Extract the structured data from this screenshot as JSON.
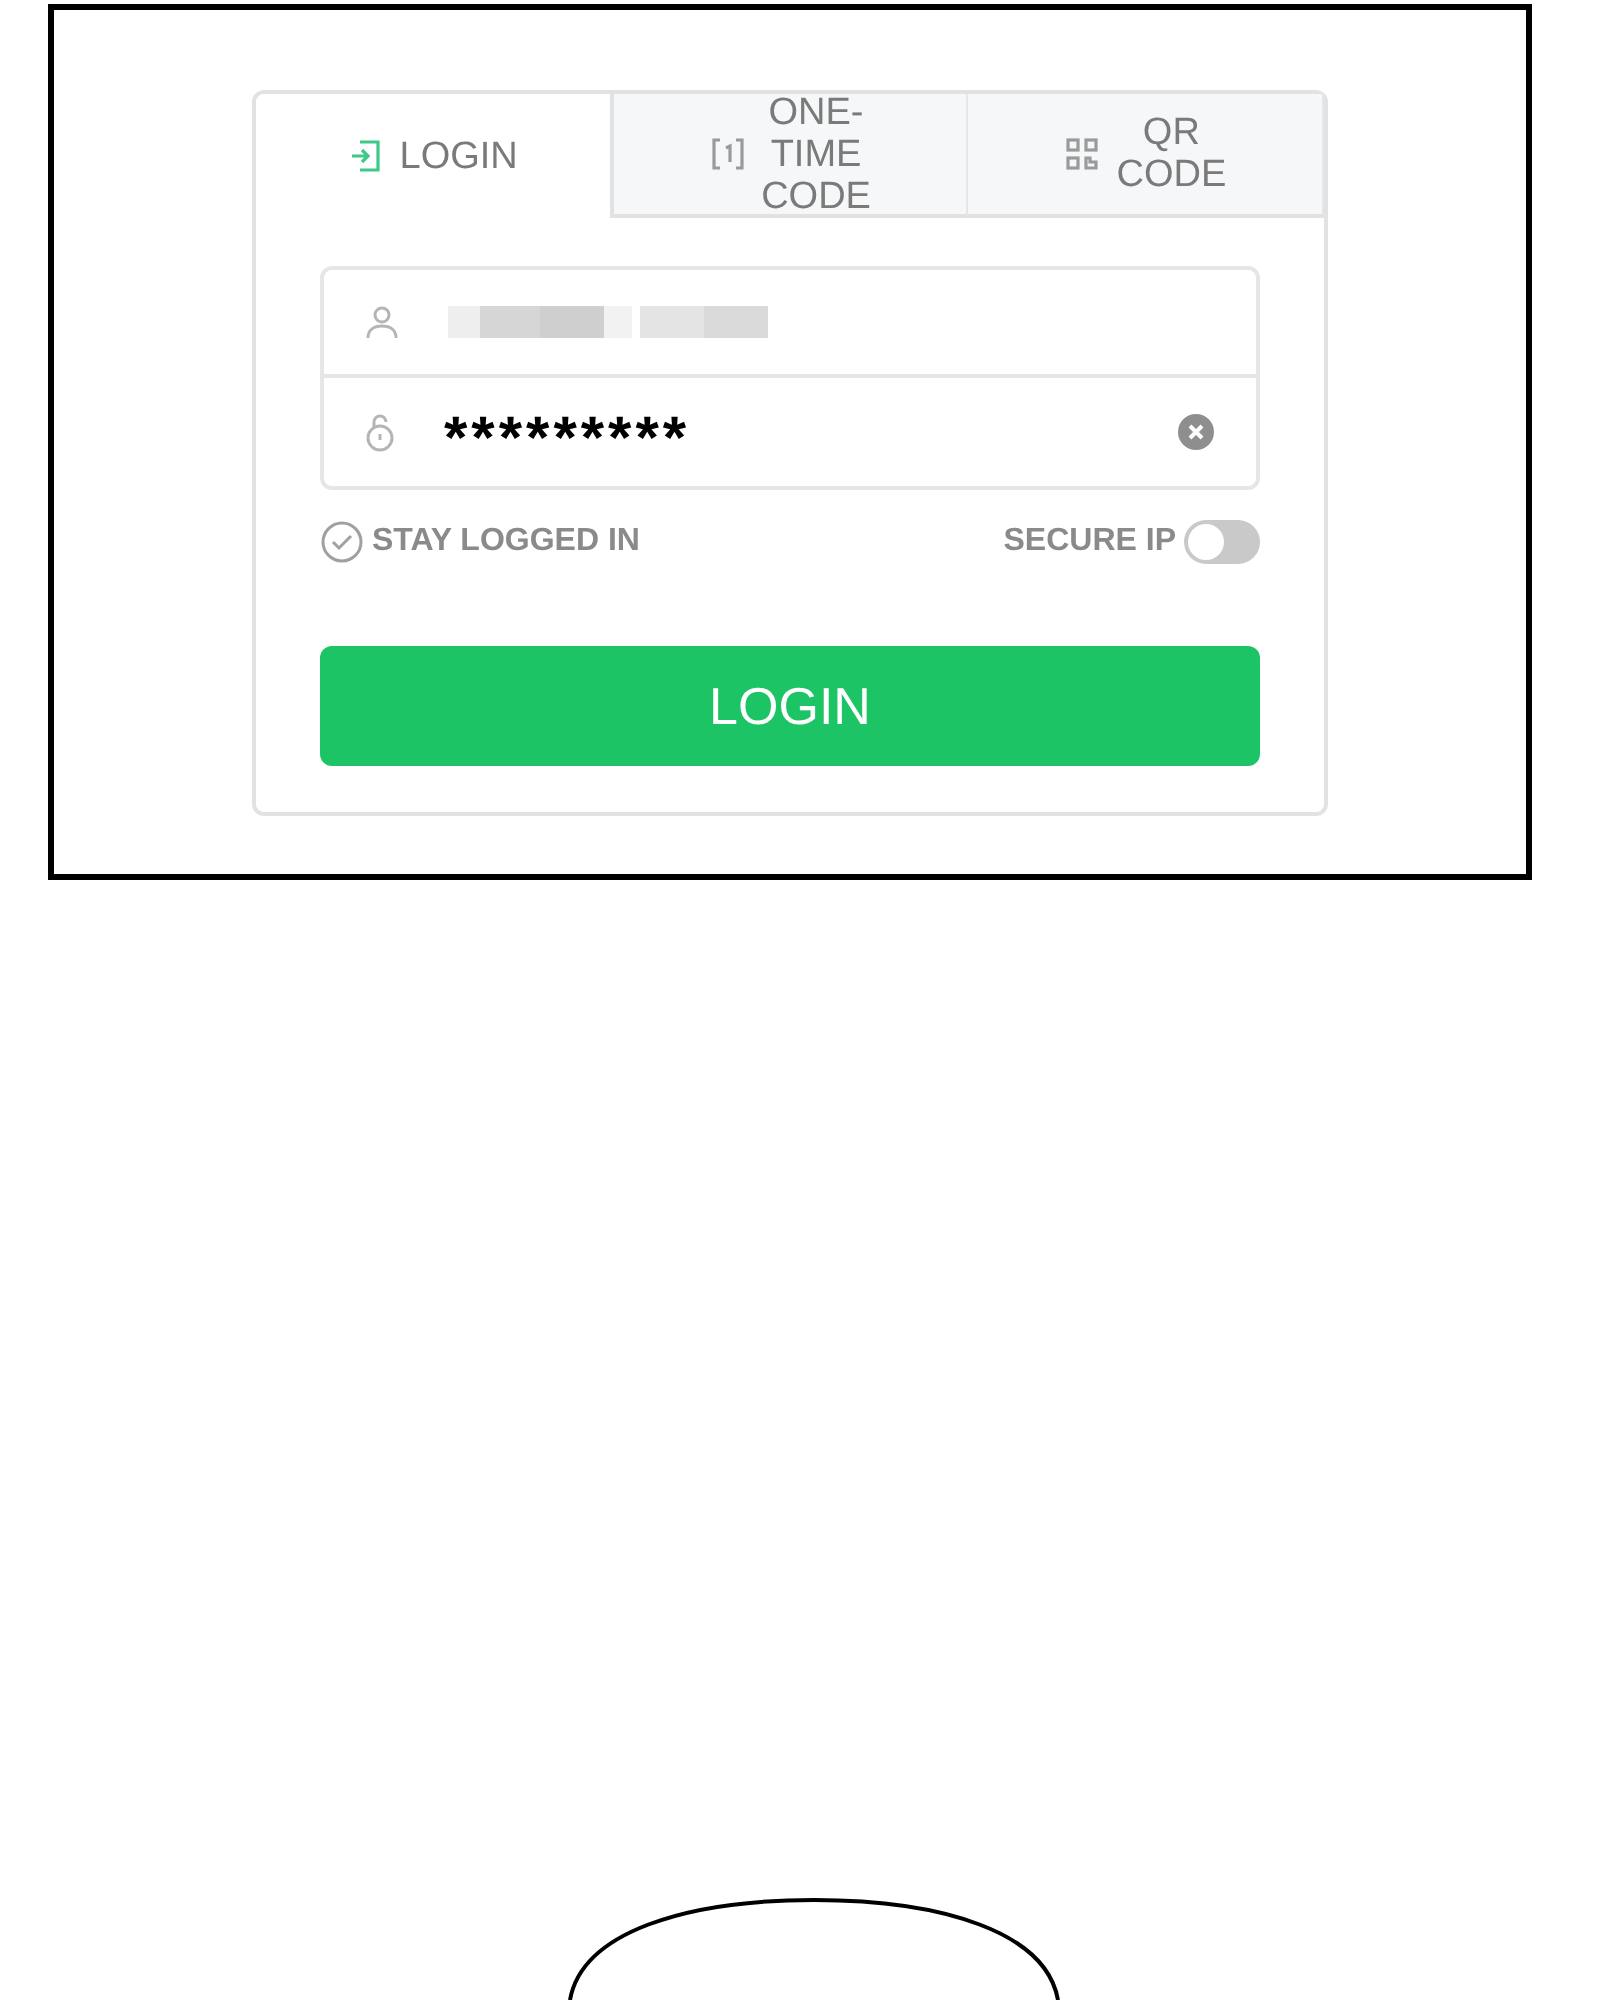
{
  "tabs": [
    {
      "kind": "login",
      "label": "LOGIN",
      "selected": true
    },
    {
      "kind": "code",
      "label": "ONE-TIME CODE",
      "selected": false
    },
    {
      "kind": "qr",
      "label": "QR CODE",
      "selected": false
    }
  ],
  "password": {
    "value": "*********"
  },
  "stay_logged_in": {
    "label": "STAY LOGGED IN",
    "checked": false
  },
  "secure_ip": {
    "label": "SECURE IP",
    "on": false
  },
  "submit": {
    "label": "LOGIN"
  }
}
